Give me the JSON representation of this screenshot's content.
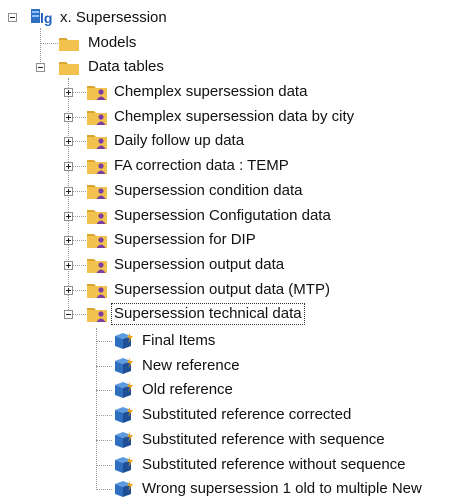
{
  "root": {
    "label": "x. Supersession",
    "icon": "database-icon"
  },
  "children": [
    {
      "label": "Models",
      "icon": "folder-icon"
    },
    {
      "label": "Data tables",
      "icon": "folder-icon"
    }
  ],
  "data_tables": [
    {
      "label": "Chemplex supersession data",
      "icon": "folder-user-icon"
    },
    {
      "label": "Chemplex supersession data by city",
      "icon": "folder-user-icon"
    },
    {
      "label": "Daily follow up data",
      "icon": "folder-user-icon"
    },
    {
      "label": "FA correction data : TEMP",
      "icon": "folder-user-icon"
    },
    {
      "label": "Supersession condition data",
      "icon": "folder-user-icon"
    },
    {
      "label": "Supersession Configutation data",
      "icon": "folder-user-icon"
    },
    {
      "label": "Supersession for DIP",
      "icon": "folder-user-icon"
    },
    {
      "label": "Supersession output data",
      "icon": "folder-user-icon"
    },
    {
      "label": "Supersession output data (MTP)",
      "icon": "folder-user-icon"
    },
    {
      "label": "Supersession technical data",
      "icon": "folder-user-icon",
      "selected": true
    }
  ],
  "technical_items": [
    {
      "label": "Final Items",
      "icon": "cube-icon"
    },
    {
      "label": "New reference",
      "icon": "cube-icon"
    },
    {
      "label": "Old reference",
      "icon": "cube-icon"
    },
    {
      "label": "Substituted reference corrected",
      "icon": "cube-icon"
    },
    {
      "label": "Substituted reference with sequence",
      "icon": "cube-icon"
    },
    {
      "label": "Substituted reference without sequence",
      "icon": "cube-icon"
    },
    {
      "label": "Wrong supersession 1 old to multiple New",
      "icon": "cube-icon"
    }
  ],
  "colors": {
    "folder": "#f2c14e",
    "folder_dark": "#d9a52e",
    "user": "#7a3fa0",
    "cube": "#2f6fc0",
    "cube_light": "#5d9be0",
    "arrow": "#e8a21a"
  }
}
